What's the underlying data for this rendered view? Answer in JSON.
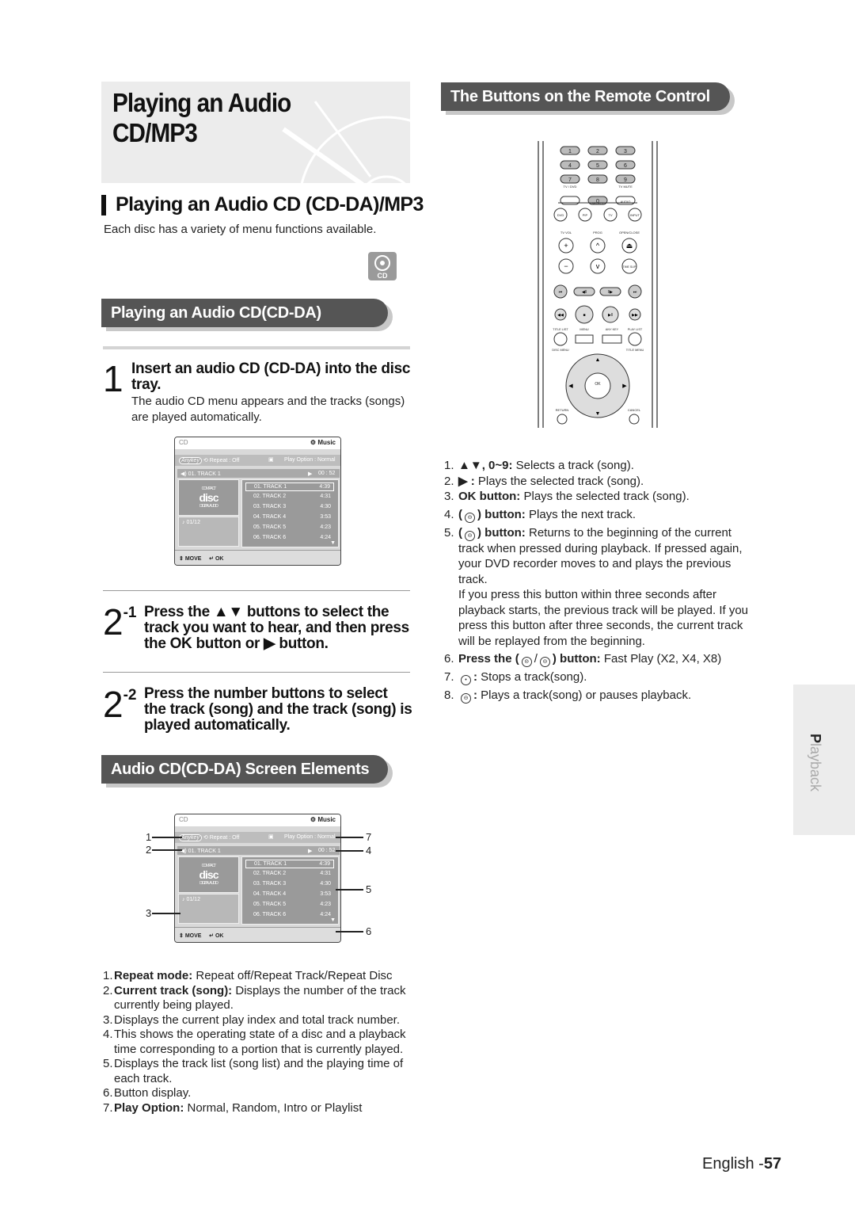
{
  "page_title": "Playing an Audio CD/MP3",
  "section_title": "Playing an Audio CD (CD-DA)/MP3",
  "intro": "Each disc has a variety of menu functions available.",
  "disc_badge": "CD",
  "banner_play": "Playing an Audio CD(CD-DA)",
  "step1": {
    "num": "1",
    "head": "Insert an audio CD (CD-DA) into the disc tray.",
    "body": "The audio CD menu appears and the tracks (songs) are played automatically."
  },
  "step21": {
    "num": "2",
    "sup": "-1",
    "head": "Press the ▲▼ buttons to select the track you want to hear, and then press the OK button or ▶ button."
  },
  "step22": {
    "num": "2",
    "sup": "-2",
    "head": "Press the number buttons to select the track (song) and the track (song) is played automatically."
  },
  "banner_screen": "Audio CD(CD-DA) Screen Elements",
  "screen": {
    "disc_type": "CD",
    "mode": "Music",
    "anykey": "Anykey",
    "repeat": "Repeat : Off",
    "play_option": "Play Option : Normal",
    "current_track": "01. TRACK 1",
    "elapsed": "00 : 52",
    "logo_top": "COMPACT",
    "logo": "disc",
    "logo_bottom": "DIGITAL AUDIO",
    "index": "01/12",
    "tracks": [
      {
        "name": "01. TRACK 1",
        "time": "4:39"
      },
      {
        "name": "02. TRACK 2",
        "time": "4:31"
      },
      {
        "name": "03. TRACK 3",
        "time": "4:30"
      },
      {
        "name": "04. TRACK 4",
        "time": "3:53"
      },
      {
        "name": "05. TRACK 5",
        "time": "4:23"
      },
      {
        "name": "06. TRACK 6",
        "time": "4:24"
      }
    ],
    "move": "MOVE",
    "ok": "OK"
  },
  "callouts": [
    "1",
    "2",
    "3",
    "4",
    "5",
    "6",
    "7"
  ],
  "screen_elements": [
    {
      "n": "1.",
      "b": "Repeat mode:",
      "t": " Repeat off/Repeat Track/Repeat Disc"
    },
    {
      "n": "2.",
      "b": "Current track (song):",
      "t": " Displays the number of the track currently being played."
    },
    {
      "n": "3.",
      "b": "",
      "t": "Displays the current play index and total track number."
    },
    {
      "n": "4.",
      "b": "",
      "t": "This shows the operating state of a disc and a playback time corresponding to a portion that is currently played."
    },
    {
      "n": "5.",
      "b": "",
      "t": "Displays the track list (song list) and the playing time of each track."
    },
    {
      "n": "6.",
      "b": "",
      "t": "Button display."
    },
    {
      "n": "7.",
      "b": "Play Option:",
      "t": " Normal, Random, Intro or Playlist"
    }
  ],
  "remote_banner": "The Buttons on the Remote Control",
  "remote": {
    "numbers": [
      "1",
      "2",
      "3",
      "4",
      "5",
      "6",
      "7",
      "8",
      "9",
      "",
      "0",
      "AUDIO"
    ],
    "labels": {
      "tv_dvd": "TV / DVD",
      "tv_mute": "TV MUTE",
      "select": "SELECT",
      "tv_vol": "TV VOL",
      "prog": "PROG",
      "open_close": "OPEN/CLOSE",
      "title_list": "TITLE LIST",
      "menu": "MENU",
      "any_key": "ANY KEY",
      "play_list": "PLAY LIST",
      "disc_menu": "DISC MENU",
      "title_menu": "TITLE MENU",
      "return": "RETURN",
      "cancel": "CANCEL"
    },
    "select_buttons": [
      "DVD",
      "PIP",
      "TV",
      "INPUT"
    ],
    "time_slip": "TIME SLIP",
    "ok": "OK"
  },
  "remote_buttons": [
    {
      "n": "1.",
      "pre": "",
      "b": "▲▼, 0~9:",
      "t": " Selects a track (song).",
      "icon": ""
    },
    {
      "n": "2.",
      "pre": "",
      "b": "▶ :",
      "t": " Plays the selected track (song).",
      "icon": ""
    },
    {
      "n": "3.",
      "pre": "",
      "b": "OK button:",
      "t": " Plays the selected track (song).",
      "icon": ""
    },
    {
      "n": "4.",
      "pre": "(",
      "icon": "skip-next-icon",
      "b": ") button:",
      "t": " Plays the next track."
    },
    {
      "n": "5.",
      "pre": "(",
      "icon": "skip-previous-icon",
      "b": ") button:",
      "t": " Returns to the beginning of the current track when pressed during playback. If pressed again, your DVD recorder moves to and plays the previous track.",
      "extra": "If you press this button within three seconds after playback starts, the previous track will be played. If you press this button after three seconds, the current track will be replayed from the beginning."
    },
    {
      "n": "6.",
      "pre": "Press the (",
      "icon": "rewind-forward-icon",
      "b": ") button:",
      "t": " Fast Play (X2, X4, X8)"
    },
    {
      "n": "7.",
      "pre": "",
      "icon": "stop-icon",
      "b": ":",
      "t": " Stops a track(song)."
    },
    {
      "n": "8.",
      "pre": "",
      "icon": "play-pause-icon",
      "b": ":",
      "t": " Plays a track(song) or pauses playback."
    }
  ],
  "side_tab": {
    "bold": "P",
    "rest": "layback"
  },
  "footer": {
    "lang": "English -",
    "page": "57"
  },
  "colors": {
    "banner": "#555555",
    "panel": "#ececec"
  }
}
